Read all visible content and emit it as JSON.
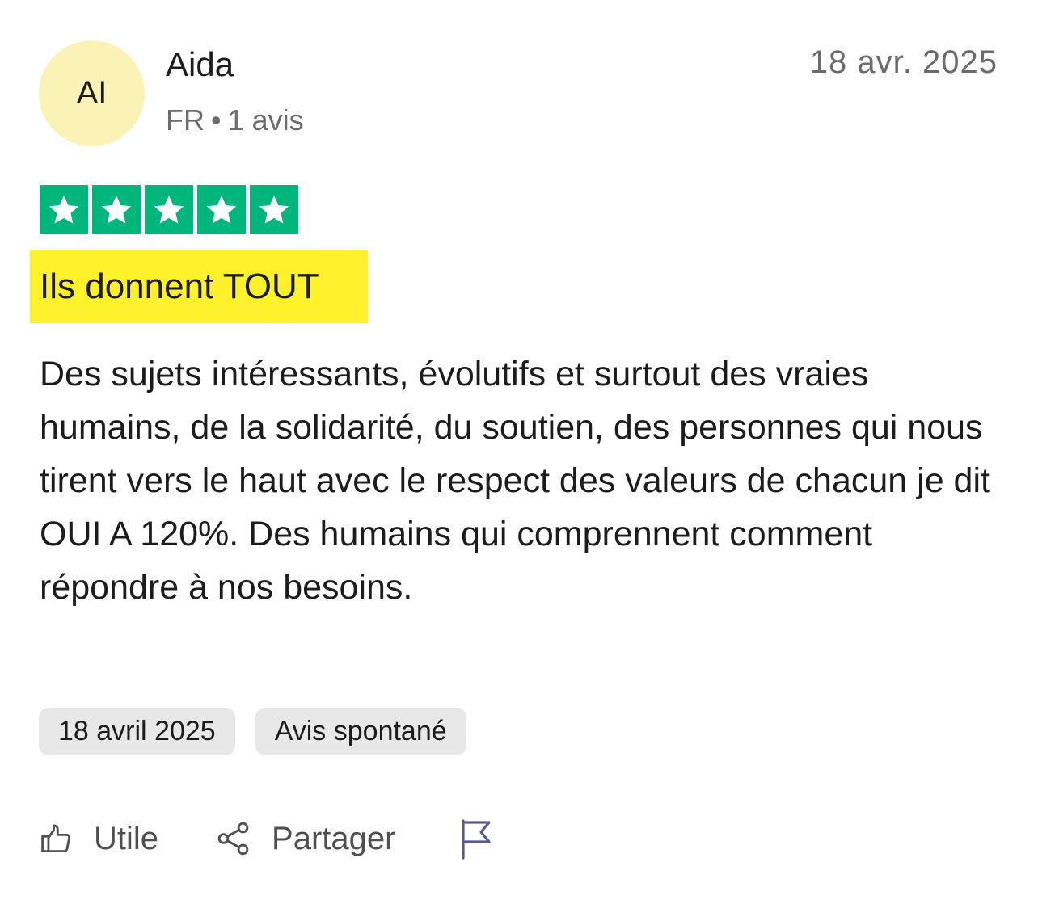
{
  "reviewer": {
    "initials": "AI",
    "name": "Aida",
    "country": "FR",
    "separator": "•",
    "review_count": "1 avis"
  },
  "review": {
    "header_date": "18 avr. 2025",
    "rating": 5,
    "rating_color": "#00b67a",
    "title": "Ils donnent TOUT",
    "title_highlight_color": "#fdf12b",
    "body": "Des sujets intéressants, évolutifs et surtout des vraies humains, de la solidarité, du soutien, des personnes qui nous tirent vers le haut avec le respect des valeurs de chacun je dit OUI A 120%. Des humains qui comprennent comment répondre à nos besoins.",
    "tags": {
      "date": "18 avril 2025",
      "type": "Avis spontané"
    }
  },
  "actions": {
    "useful": {
      "label": "Utile",
      "icon": "thumbs-up-icon"
    },
    "share": {
      "label": "Partager",
      "icon": "share-icon"
    },
    "report": {
      "icon": "flag-icon"
    }
  }
}
